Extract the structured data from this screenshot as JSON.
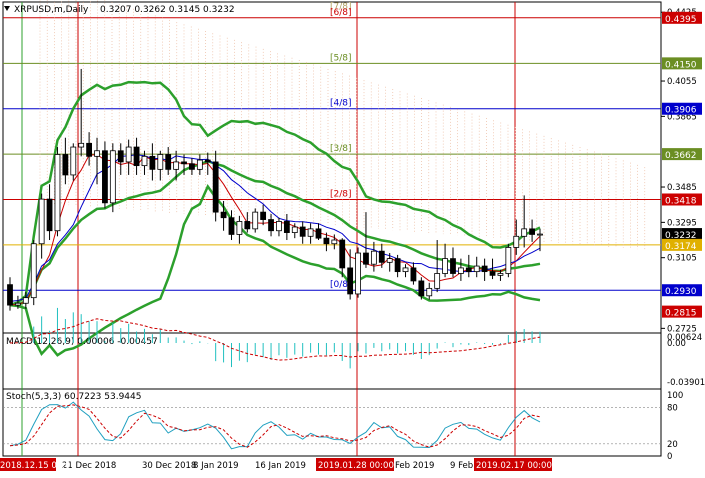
{
  "chart_data": {
    "type": "candlestick",
    "symbol_label": "XRPUSD,m,Daily",
    "ohlc_label": "0.3207 0.3262 0.3145 0.3232",
    "price_axis": {
      "ylim": [
        0.27,
        0.448
      ],
      "ticks": [
        "0.4425",
        "0.4055",
        "0.3865",
        "0.3485",
        "0.3295",
        "0.3105",
        "0.2725"
      ]
    },
    "x_axis": {
      "labels": [
        "21 Dec 2018",
        "30 Dec 2018",
        "8 Jan 2019",
        "16 Jan 2019",
        "Feb 2019",
        "9 Feb"
      ],
      "highlight_labels": [
        "2018.12.15 00:00",
        "2019.01.28 00:00",
        "2019.02.17 00:00"
      ]
    },
    "murrey_levels": [
      {
        "label": "[7/8]",
        "value": 0.464,
        "color": "#b0a060"
      },
      {
        "label": "[6/8]",
        "value": 0.4395,
        "color": "#cc0000",
        "tag": "0.4395"
      },
      {
        "label": "[5/8]",
        "value": 0.415,
        "color": "#6b8e23",
        "tag": "0.4150"
      },
      {
        "label": "[4/8]",
        "value": 0.3906,
        "color": "#0000cc",
        "tag": "0.3906"
      },
      {
        "label": "[3/8]",
        "value": 0.3662,
        "color": "#6b8e23",
        "tag": "0.3662"
      },
      {
        "label": "[2/8]",
        "value": 0.3418,
        "color": "#cc0000",
        "tag": "0.3418"
      },
      {
        "label": "[0/8]",
        "value": 0.293,
        "color": "#0000cc",
        "tag": "0.2930"
      }
    ],
    "extra_tags": [
      {
        "value": 0.2815,
        "text": "0.2815",
        "bg": "#cc0000"
      },
      {
        "value": 0.3232,
        "text": "0.3232",
        "bg": "#000000"
      },
      {
        "value": 0.3174,
        "text": "0.3174",
        "bg": "#e0b000"
      }
    ],
    "candles": [
      [
        0.296,
        0.3,
        0.282,
        0.285
      ],
      [
        0.285,
        0.29,
        0.283,
        0.286
      ],
      [
        0.286,
        0.292,
        0.283,
        0.289
      ],
      [
        0.289,
        0.32,
        0.285,
        0.318
      ],
      [
        0.318,
        0.345,
        0.31,
        0.342
      ],
      [
        0.342,
        0.35,
        0.32,
        0.325
      ],
      [
        0.325,
        0.37,
        0.322,
        0.366
      ],
      [
        0.366,
        0.375,
        0.35,
        0.355
      ],
      [
        0.355,
        0.372,
        0.352,
        0.37
      ],
      [
        0.37,
        0.412,
        0.365,
        0.372
      ],
      [
        0.372,
        0.378,
        0.36,
        0.365
      ],
      [
        0.365,
        0.375,
        0.35,
        0.368
      ],
      [
        0.368,
        0.373,
        0.337,
        0.34
      ],
      [
        0.34,
        0.372,
        0.335,
        0.368
      ],
      [
        0.368,
        0.372,
        0.355,
        0.362
      ],
      [
        0.362,
        0.374,
        0.355,
        0.37
      ],
      [
        0.37,
        0.375,
        0.355,
        0.36
      ],
      [
        0.36,
        0.368,
        0.355,
        0.365
      ],
      [
        0.365,
        0.372,
        0.352,
        0.358
      ],
      [
        0.358,
        0.368,
        0.352,
        0.366
      ],
      [
        0.366,
        0.37,
        0.355,
        0.358
      ],
      [
        0.358,
        0.368,
        0.352,
        0.362
      ],
      [
        0.362,
        0.366,
        0.355,
        0.361
      ],
      [
        0.361,
        0.364,
        0.355,
        0.358
      ],
      [
        0.358,
        0.366,
        0.355,
        0.363
      ],
      [
        0.363,
        0.367,
        0.355,
        0.362
      ],
      [
        0.362,
        0.368,
        0.33,
        0.335
      ],
      [
        0.335,
        0.341,
        0.325,
        0.332
      ],
      [
        0.332,
        0.336,
        0.32,
        0.323
      ],
      [
        0.323,
        0.333,
        0.318,
        0.33
      ],
      [
        0.33,
        0.335,
        0.324,
        0.326
      ],
      [
        0.326,
        0.337,
        0.324,
        0.335
      ],
      [
        0.335,
        0.339,
        0.328,
        0.331
      ],
      [
        0.331,
        0.334,
        0.322,
        0.325
      ],
      [
        0.325,
        0.332,
        0.322,
        0.33
      ],
      [
        0.33,
        0.334,
        0.32,
        0.324
      ],
      [
        0.324,
        0.329,
        0.321,
        0.327
      ],
      [
        0.327,
        0.33,
        0.318,
        0.322
      ],
      [
        0.322,
        0.329,
        0.318,
        0.326
      ],
      [
        0.326,
        0.329,
        0.32,
        0.321
      ],
      [
        0.321,
        0.324,
        0.314,
        0.318
      ],
      [
        0.318,
        0.323,
        0.315,
        0.32
      ],
      [
        0.32,
        0.321,
        0.3,
        0.305
      ],
      [
        0.305,
        0.315,
        0.288,
        0.291
      ],
      [
        0.291,
        0.316,
        0.289,
        0.313
      ],
      [
        0.313,
        0.335,
        0.305,
        0.307
      ],
      [
        0.307,
        0.319,
        0.303,
        0.314
      ],
      [
        0.314,
        0.318,
        0.305,
        0.308
      ],
      [
        0.308,
        0.313,
        0.303,
        0.31
      ],
      [
        0.31,
        0.312,
        0.3,
        0.303
      ],
      [
        0.303,
        0.307,
        0.3,
        0.305
      ],
      [
        0.305,
        0.308,
        0.296,
        0.298
      ],
      [
        0.298,
        0.3,
        0.288,
        0.29
      ],
      [
        0.29,
        0.297,
        0.288,
        0.294
      ],
      [
        0.294,
        0.32,
        0.292,
        0.302
      ],
      [
        0.302,
        0.318,
        0.3,
        0.31
      ],
      [
        0.31,
        0.316,
        0.3,
        0.302
      ],
      [
        0.302,
        0.31,
        0.298,
        0.305
      ],
      [
        0.305,
        0.312,
        0.3,
        0.303
      ],
      [
        0.303,
        0.311,
        0.3,
        0.306
      ],
      [
        0.306,
        0.31,
        0.298,
        0.303
      ],
      [
        0.303,
        0.31,
        0.299,
        0.301
      ],
      [
        0.301,
        0.304,
        0.298,
        0.302
      ],
      [
        0.302,
        0.318,
        0.3,
        0.316
      ],
      [
        0.316,
        0.331,
        0.312,
        0.322
      ],
      [
        0.322,
        0.344,
        0.316,
        0.326
      ],
      [
        0.326,
        0.331,
        0.319,
        0.323
      ],
      [
        0.323,
        0.326,
        0.314,
        0.3232
      ]
    ],
    "macd": {
      "label": "MACD(12,26,9) 0.00006 -0.00457",
      "ylim": [
        -0.046,
        0.01
      ],
      "ticks": [
        "0.00624",
        "0.00",
        "-0.03901"
      ]
    },
    "stoch": {
      "label": "Stoch(5,3,3) 60.7223 53.9445",
      "ylim": [
        0,
        110
      ],
      "ticks": [
        "100",
        "80",
        "20",
        "0"
      ]
    }
  }
}
